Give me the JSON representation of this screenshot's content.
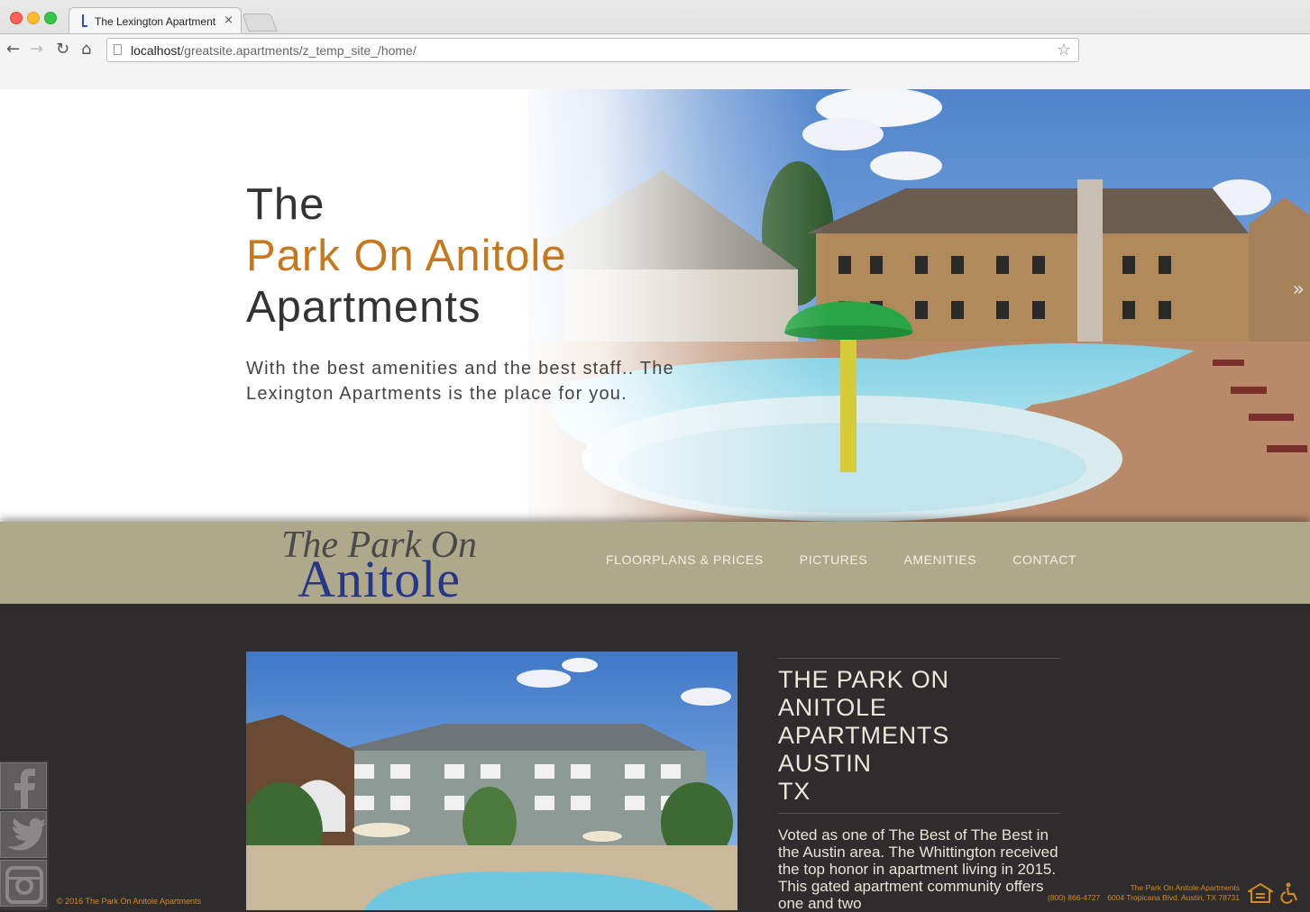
{
  "browser": {
    "tab_title": "The Lexington Apartments",
    "tab_close": "×",
    "url_host": "localhost",
    "url_path": "/greatsite.apartments/z_temp_site_/home/",
    "nav_back": "←",
    "nav_forward": "→",
    "nav_reload": "↻",
    "nav_home": "⌂",
    "bookmark_star": "☆"
  },
  "hero": {
    "title_line1": "The",
    "title_line2": "Park On Anitole",
    "title_line3": "Apartments",
    "subtitle": "With the best amenities and the best staff.. The Lexington Apartments is the place for you.",
    "next_arrow": "»",
    "accent_color": "#c8781c"
  },
  "header": {
    "logo_line1": "The Park On",
    "logo_line2": "Anitole",
    "menu": [
      {
        "label": "FLOORPLANS & PRICES"
      },
      {
        "label": "PICTURES"
      },
      {
        "label": "AMENITIES"
      },
      {
        "label": "CONTACT"
      }
    ],
    "background_color": "#aea98a"
  },
  "main": {
    "title_lines": [
      "THE PARK ON",
      "ANITOLE",
      "APARTMENTS",
      "AUSTIN",
      "TX"
    ],
    "description": "Voted as one of The Best of The Best in the Austin area. The Whittington received the top honor in apartment living in 2015. This gated apartment community offers one and two"
  },
  "social": {
    "items": [
      "facebook-icon",
      "twitter-icon",
      "instagram-icon"
    ]
  },
  "footer": {
    "copyright": "© 2016 The Park On Anitole Apartments",
    "name": "The Park On Anitole Apartments",
    "phone": "(800) 866-4727",
    "address": "6004 Tropicana Blvd. Austin, TX 78731",
    "accent_color": "#d48b1e"
  }
}
